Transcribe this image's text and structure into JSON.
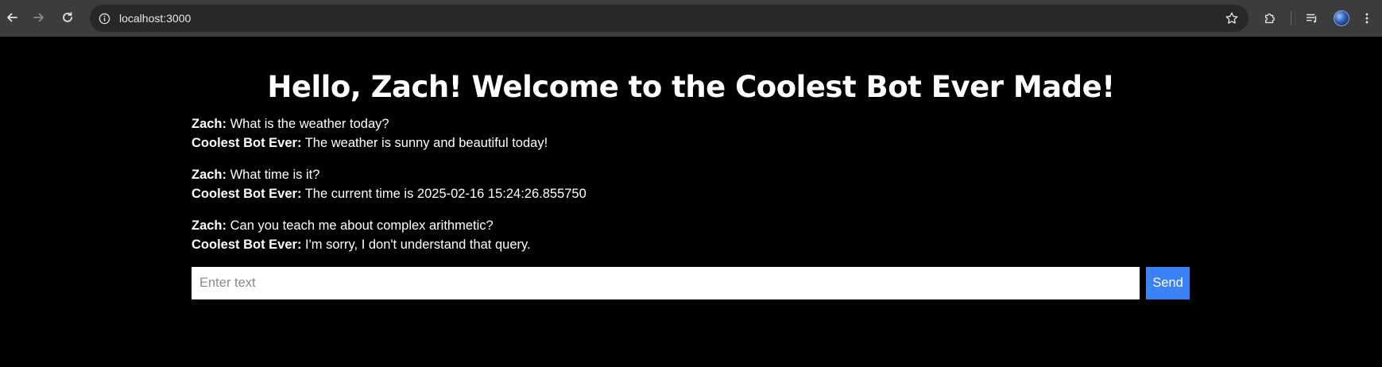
{
  "browser": {
    "url": "localhost:3000",
    "icons": [
      "back-arrow-icon",
      "forward-arrow-icon",
      "reload-icon",
      "site-info-icon",
      "bookmark-star-icon",
      "extensions-puzzle-icon",
      "media-queue-icon",
      "profile-avatar",
      "kebab-menu-icon"
    ]
  },
  "page": {
    "title": "Hello, Zach! Welcome to the Coolest Bot Ever Made!"
  },
  "chat": {
    "exchanges": [
      {
        "user_name": "Zach:",
        "user_text": " What is the weather today?",
        "bot_name": "Coolest Bot Ever:",
        "bot_text": " The weather is sunny and beautiful today!"
      },
      {
        "user_name": "Zach:",
        "user_text": " What time is it?",
        "bot_name": "Coolest Bot Ever:",
        "bot_text": " The current time is 2025-02-16 15:24:26.855750"
      },
      {
        "user_name": "Zach:",
        "user_text": " Can you teach me about complex arithmetic?",
        "bot_name": "Coolest Bot Ever:",
        "bot_text": " I'm sorry, I don't understand that query."
      }
    ]
  },
  "input": {
    "placeholder": "Enter text",
    "value": "",
    "send_label": "Send"
  },
  "colors": {
    "background": "#000000",
    "accent": "#3b82f6",
    "text": "#ffffff"
  }
}
